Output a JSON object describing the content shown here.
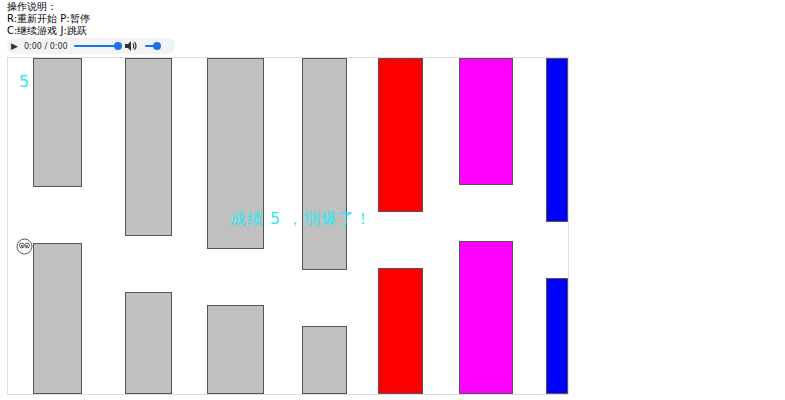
{
  "instructions": {
    "title": "操作说明：",
    "lines": [
      "R:重新开始 P:暂停",
      "C:继续游戏 J:跳跃"
    ]
  },
  "audio": {
    "play": "▶",
    "time": "0:00 / 0:00",
    "seek_level": 1,
    "volume_level": 1
  },
  "game": {
    "score": "5",
    "message": "成绩 5 ，弱爆了！",
    "pipes": [
      {
        "color": "#c0c0c0"
      },
      {
        "color": "#c0c0c0"
      },
      {
        "color": "#c0c0c0"
      },
      {
        "color": "#c0c0c0"
      },
      {
        "color": "#ff0000"
      },
      {
        "color": "#ff00ff"
      },
      {
        "color": "#0000ff"
      }
    ]
  }
}
